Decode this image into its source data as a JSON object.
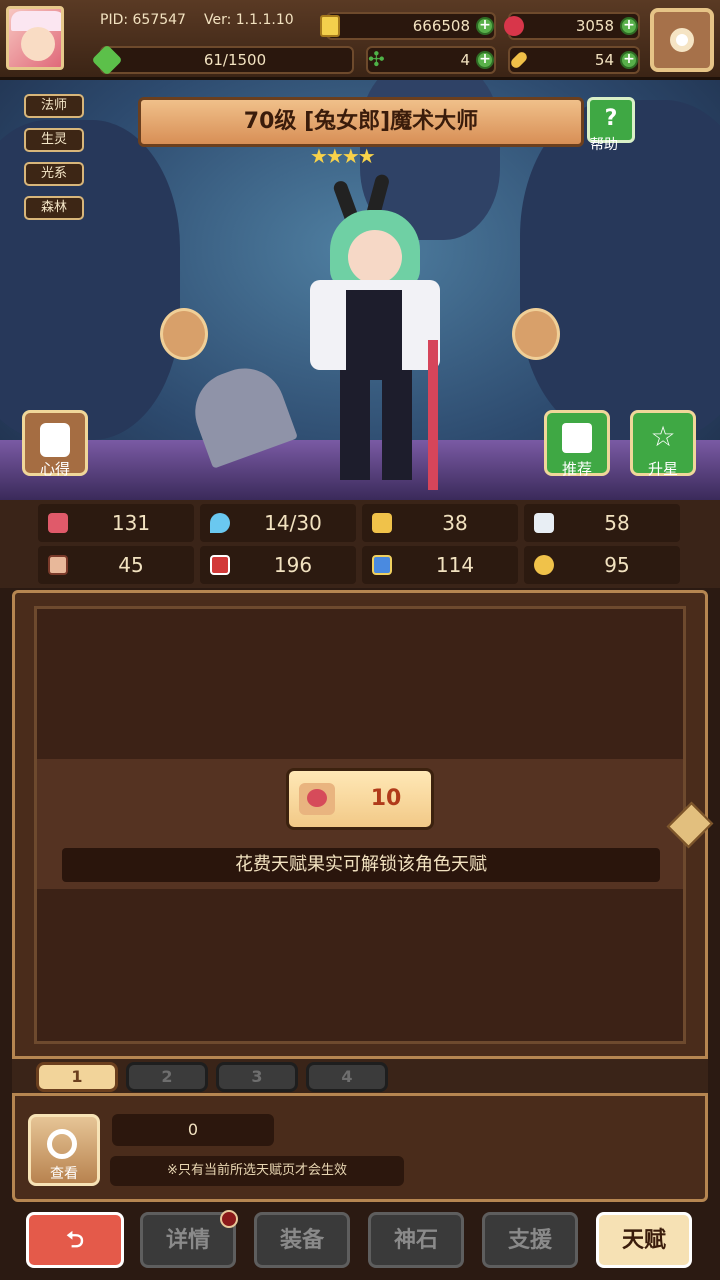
{
  "header": {
    "pid": "PID: 657547",
    "version": "Ver: 1.1.1.10",
    "exp": "61/1500",
    "coins": "666508",
    "gems": "3058",
    "clover": "4",
    "bone": "54"
  },
  "colors": {
    "accent": "#e7c98c",
    "green": "#58b04a",
    "red": "#e45a4a"
  },
  "tags": [
    "法师",
    "生灵",
    "光系",
    "森林"
  ],
  "hero": {
    "title": "70级 [兔女郎]魔术大师",
    "stars": "★★★★",
    "help_label": "帮助",
    "help_icon": "?"
  },
  "side_buttons": {
    "xinde": "心得",
    "tuijian": "推荐",
    "shengxing": "升星"
  },
  "stats": [
    {
      "icon": "heart-icon",
      "value": "131"
    },
    {
      "icon": "mana-drop-icon",
      "value": "14/30"
    },
    {
      "icon": "shield-icon",
      "value": "38"
    },
    {
      "icon": "wing-icon",
      "value": "58"
    },
    {
      "icon": "fist-icon",
      "value": "45"
    },
    {
      "icon": "book-icon",
      "value": "196"
    },
    {
      "icon": "flag-icon",
      "value": "114"
    },
    {
      "icon": "horseshoe-icon",
      "value": "95"
    }
  ],
  "talent": {
    "cost": "10",
    "note": "花费天赋果实可解锁该角色天赋",
    "pages": [
      "1",
      "2",
      "3",
      "4"
    ],
    "fruit_count": "0",
    "hint": "※只有当前所选天赋页才会生效",
    "view_label": "查看"
  },
  "nav": {
    "detail": "详情",
    "equip": "装备",
    "stone": "神石",
    "support": "支援",
    "talent": "天赋"
  }
}
